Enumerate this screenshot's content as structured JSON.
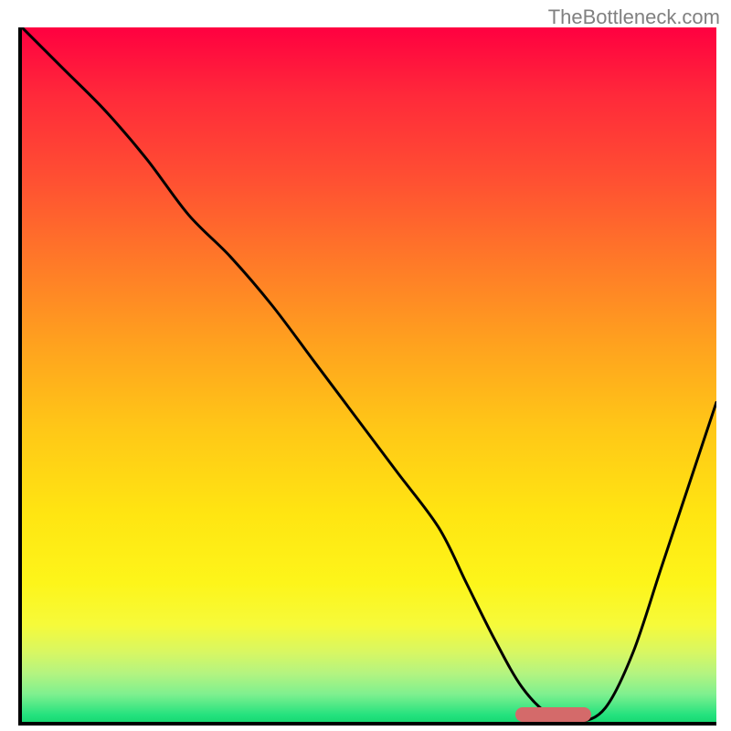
{
  "watermark": "TheBottleneck.com",
  "chart_data": {
    "type": "line",
    "title": "",
    "xlabel": "",
    "ylabel": "",
    "xlim": [
      0,
      100
    ],
    "ylim": [
      0,
      100
    ],
    "grid": false,
    "background_gradient": {
      "top_color": "#ff0040",
      "bottom_color": "#18d973"
    },
    "series": [
      {
        "name": "bottleneck-curve",
        "x": [
          0,
          6,
          12,
          18,
          24,
          30,
          36,
          42,
          48,
          54,
          60,
          64,
          68,
          72,
          76,
          80,
          84,
          88,
          92,
          96,
          100
        ],
        "values": [
          100,
          94,
          88,
          81,
          73,
          67,
          60,
          52,
          44,
          36,
          28,
          20,
          12,
          5,
          1,
          0,
          2,
          10,
          22,
          34,
          46
        ]
      }
    ],
    "annotations": [
      {
        "name": "optimal-range-marker",
        "axis": "x",
        "start": 71,
        "end": 82,
        "y": 1,
        "color": "#d46a6a"
      }
    ]
  }
}
